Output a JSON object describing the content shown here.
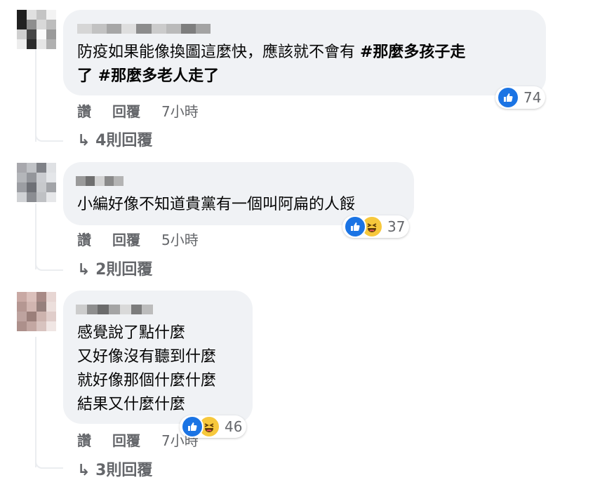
{
  "comments": [
    {
      "text_html": "防疫如果能像換圖這麼快，應該就不會有 <b>#那麼多孩子走</b><br><b>了 #那麼多老人走了</b>",
      "reaction_count": "74",
      "like_label": "讚",
      "reply_label": "回覆",
      "time": "7小時",
      "replies": "4則回覆",
      "avatar_colors": [
        "#1f1f1f",
        "#e0e0e0",
        "#c4c4c4",
        "#f3f3f3",
        "#222222",
        "#8e8e8e",
        "#d8d8d8",
        "#bdbdbd",
        "#cfcfcf",
        "#464646",
        "#fafafa",
        "#9a9a9a",
        "#ededed",
        "#2a2a2a",
        "#e6e6e6",
        "#b0b0b0"
      ],
      "name_colors": [
        "#d6d6d6",
        "#c2c2c2",
        "#a6a6a6",
        "#dedede",
        "#8c8c8c",
        "#cbcbcb",
        "#bababa",
        "#7e7e7e",
        "#a3a3a3"
      ]
    },
    {
      "text_html": "小編好像不知道貴黨有一個叫阿扁的人餒",
      "reaction_count": "37",
      "like_label": "讚",
      "reply_label": "回覆",
      "time": "5小時",
      "replies": "2則回覆",
      "avatar_colors": [
        "#a8a8ad",
        "#c0c2c6",
        "#7f8187",
        "#dfe1e4",
        "#b4b6ba",
        "#94969b",
        "#caccd0",
        "#e4e6e9",
        "#9c9ea3",
        "#6e7076",
        "#c7c9cc",
        "#a2a4a8",
        "#d0d2d5",
        "#8b8d92",
        "#bfc1c4",
        "#e6e7e9"
      ],
      "name_colors": [
        "#9a9a9a",
        "#6f6f6f",
        "#d2d2d2",
        "#8a8a8a",
        "#b4b4b4"
      ]
    },
    {
      "text_html": "感覺說了點什麼<br>又好像沒有聽到什麼<br>就好像那個什麼什麼<br>結果又什麼什麼",
      "reaction_count": "46",
      "like_label": "讚",
      "reply_label": "回覆",
      "time": "7小時",
      "replies": "3則回覆",
      "avatar_colors": [
        "#c9a9a4",
        "#dbc0bb",
        "#a88a86",
        "#e7d6d3",
        "#b59792",
        "#d1b5b0",
        "#96807c",
        "#ecdfdc",
        "#bea39f",
        "#9b7f7a",
        "#cdb3ae",
        "#e0cdca",
        "#ad908b",
        "#c3a7a2",
        "#d8c3bf",
        "#f0e6e4"
      ],
      "name_colors": [
        "#cccccc",
        "#8e8e8e",
        "#6b6b6b",
        "#a4a4a4",
        "#d9d9d9",
        "#7c7c7c",
        "#bcbcbc"
      ]
    }
  ]
}
